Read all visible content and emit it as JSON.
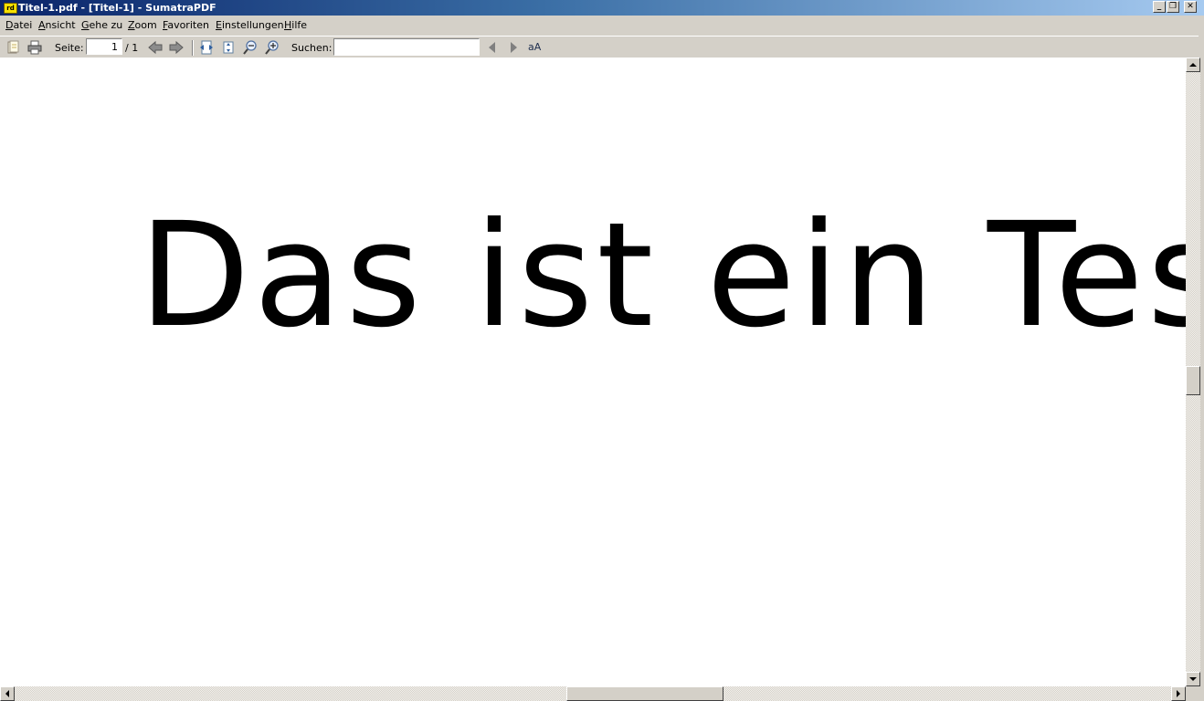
{
  "window": {
    "title": "Titel-1.pdf - [Titel-1] - SumatraPDF",
    "icon_label": "rd",
    "minimize_glyph": "_",
    "restore_glyph": "❐",
    "close_glyph": "✕"
  },
  "menu": {
    "items": [
      {
        "label": "Datei"
      },
      {
        "label": "Ansicht"
      },
      {
        "label": "Gehe zu"
      },
      {
        "label": "Zoom"
      },
      {
        "label": "Favoriten"
      },
      {
        "label": "Einstellungen"
      },
      {
        "label": "Hilfe"
      }
    ]
  },
  "toolbar": {
    "page_label": "Seite:",
    "page_value": "1",
    "page_total": "/ 1",
    "search_label": "Suchen:",
    "search_value": "",
    "match_case_glyph": "aA",
    "icons": [
      "open-icon",
      "print-icon",
      "prev-page-icon",
      "next-page-icon",
      "fit-width-icon",
      "fit-page-icon",
      "zoom-out-icon",
      "zoom-in-icon",
      "find-prev-icon",
      "find-next-icon",
      "match-case-icon"
    ]
  },
  "document": {
    "text": "Das ist ein Test"
  },
  "colors": {
    "titlebar_start": "#0a246a",
    "titlebar_end": "#a6caf0",
    "chrome": "#d4d0c8",
    "page": "#ffffff"
  }
}
